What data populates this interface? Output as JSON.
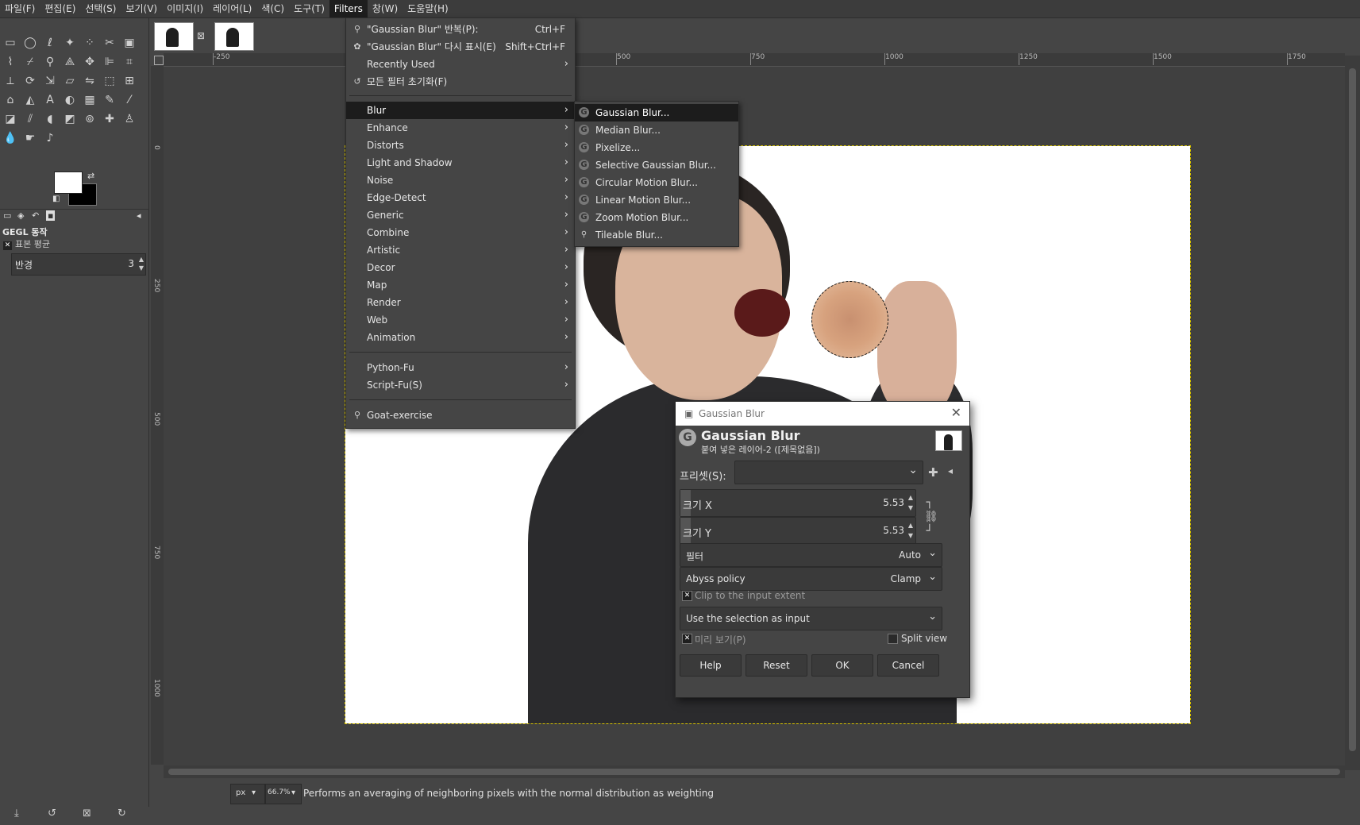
{
  "menubar": {
    "items": [
      "파일(F)",
      "편집(E)",
      "선택(S)",
      "보기(V)",
      "이미지(I)",
      "레이어(L)",
      "색(C)",
      "도구(T)",
      "Filters",
      "창(W)",
      "도움말(H)"
    ],
    "active": "Filters"
  },
  "filters_menu": {
    "repeat_label": "\"Gaussian Blur\" 반복(P):",
    "repeat_shortcut": "Ctrl+F",
    "reshow_label": "\"Gaussian Blur\" 다시 표시(E)",
    "reshow_shortcut": "Shift+Ctrl+F",
    "recently_used": "Recently Used",
    "reset_all": "모든 필터 초기화(F)",
    "categories": [
      "Blur",
      "Enhance",
      "Distorts",
      "Light and Shadow",
      "Noise",
      "Edge-Detect",
      "Generic",
      "Combine",
      "Artistic",
      "Decor",
      "Map",
      "Render",
      "Web",
      "Animation"
    ],
    "scripts": [
      "Python-Fu",
      "Script-Fu(S)"
    ],
    "goat": "Goat-exercise"
  },
  "blur_menu": {
    "items": [
      "Gaussian Blur...",
      "Median Blur...",
      "Pixelize...",
      "Selective Gaussian Blur...",
      "Circular Motion Blur...",
      "Linear Motion Blur...",
      "Zoom Motion Blur...",
      "Tileable Blur..."
    ]
  },
  "toolbox": {
    "gegl_title": "GEGL 동작",
    "gegl_subtitle": "표본 평균",
    "radius_label": "반경",
    "radius_value": "3"
  },
  "rulers": {
    "h_ticks": [
      "-250",
      "500",
      "750",
      "1000",
      "1250",
      "1500",
      "1750"
    ],
    "v_ticks": [
      "0",
      "250",
      "500",
      "750",
      "1000"
    ]
  },
  "status": {
    "unit": "px",
    "zoom": "66.7%",
    "message": "Performs an averaging of neighboring pixels with the normal distribution as weighting"
  },
  "dialog": {
    "window_title": "Gaussian Blur",
    "heading": "Gaussian Blur",
    "subheading": "붙여 넣은 레이어-2 ([제목없음])",
    "preset_label": "프리셋(S):",
    "size_x_label": "크기 X",
    "size_x_value": "5.53",
    "size_y_label": "크기 Y",
    "size_y_value": "5.53",
    "filter_label": "필터",
    "filter_value": "Auto",
    "abyss_label": "Abyss policy",
    "abyss_value": "Clamp",
    "clip_label": "Clip to the input extent",
    "input_combo": "Use the selection as input",
    "preview_label": "미리 보기(P)",
    "split_view_label": "Split view",
    "buttons": {
      "help": "Help",
      "reset": "Reset",
      "ok": "OK",
      "cancel": "Cancel"
    }
  }
}
